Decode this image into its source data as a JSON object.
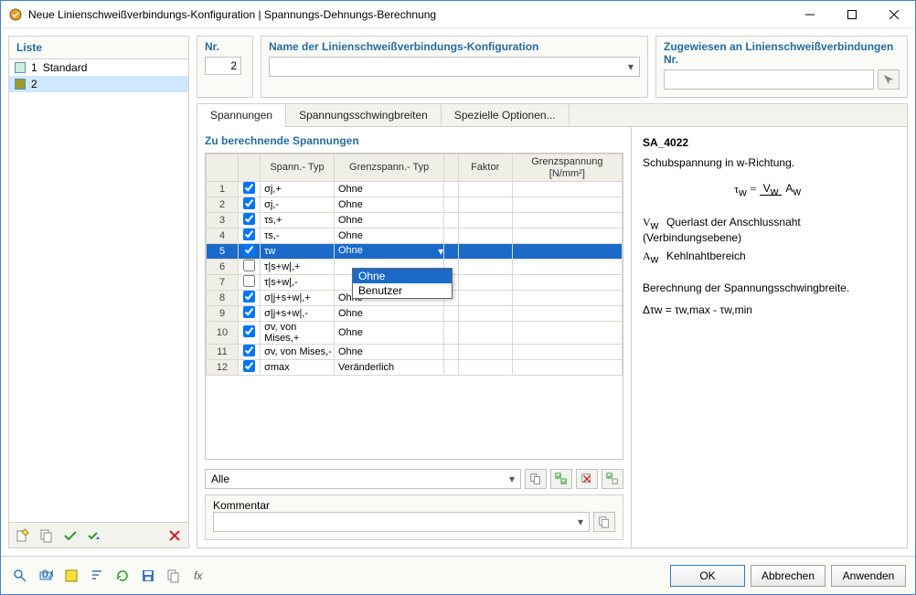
{
  "window": {
    "title": "Neue Linienschweißverbindungs-Konfiguration | Spannungs-Dehnungs-Berechnung"
  },
  "left": {
    "header": "Liste",
    "items": [
      {
        "num": "1",
        "label": "Standard",
        "color": "#cdeede"
      },
      {
        "num": "2",
        "label": "",
        "color": "#9b9b2c"
      }
    ]
  },
  "top": {
    "nr_label": "Nr.",
    "nr_value": "2",
    "name_label": "Name der Linienschweißverbindungs-Konfiguration",
    "name_value": "",
    "assign_label": "Zugewiesen an Linienschweißverbindungen Nr.",
    "assign_value": ""
  },
  "tabs": {
    "spannungen": "Spannungen",
    "schwing": "Spannungsschwingbreiten",
    "spezielle": "Spezielle Optionen..."
  },
  "section": {
    "title": "Zu berechnende Spannungen",
    "cols": {
      "spanntyp": "Spann.-\nTyp",
      "grenztyp": "Grenzspann.-\nTyp",
      "faktor": "Faktor",
      "grenzspan": "Grenzspannung\n[N/mm²]"
    },
    "rows": [
      {
        "n": "1",
        "chk": true,
        "s": "σj,+",
        "g": "Ohne",
        "f": "",
        "gs": ""
      },
      {
        "n": "2",
        "chk": true,
        "s": "σj,-",
        "g": "Ohne",
        "f": "",
        "gs": ""
      },
      {
        "n": "3",
        "chk": true,
        "s": "τs,+",
        "g": "Ohne",
        "f": "",
        "gs": ""
      },
      {
        "n": "4",
        "chk": true,
        "s": "τs,-",
        "g": "Ohne",
        "f": "",
        "gs": ""
      },
      {
        "n": "5",
        "chk": true,
        "s": "τw",
        "g": "Ohne",
        "f": "",
        "gs": "",
        "sel": true
      },
      {
        "n": "6",
        "chk": false,
        "s": "τ|s+w|,+",
        "g": "",
        "f": "",
        "gs": ""
      },
      {
        "n": "7",
        "chk": false,
        "s": "τ|s+w|,-",
        "g": "",
        "f": "",
        "gs": ""
      },
      {
        "n": "8",
        "chk": true,
        "s": "σ|j+s+w|,+",
        "g": "Ohne",
        "f": "",
        "gs": ""
      },
      {
        "n": "9",
        "chk": true,
        "s": "σ|j+s+w|,-",
        "g": "Ohne",
        "f": "",
        "gs": ""
      },
      {
        "n": "10",
        "chk": true,
        "s": "σv, von Mises,+",
        "g": "Ohne",
        "f": "",
        "gs": ""
      },
      {
        "n": "11",
        "chk": true,
        "s": "σv, von Mises,-",
        "g": "Ohne",
        "f": "",
        "gs": ""
      },
      {
        "n": "12",
        "chk": true,
        "s": "σmax",
        "g": "Veränderlich",
        "f": "",
        "gs": ""
      }
    ],
    "dropdown": {
      "opt1": "Ohne",
      "opt2": "Benutzer"
    },
    "filter": "Alle"
  },
  "comment": {
    "label": "Kommentar",
    "value": ""
  },
  "info": {
    "code": "SA_4022",
    "desc": "Schubspannung in w-Richtung.",
    "vw": "Querlast der Anschlussnaht (Verbindungsebene)",
    "aw": "Kehlnahtbereich",
    "calc": "Berechnung der Spannungsschwingbreite.",
    "delta": "Δτw = τw,max - τw,min"
  },
  "buttons": {
    "ok": "OK",
    "cancel": "Abbrechen",
    "apply": "Anwenden"
  }
}
